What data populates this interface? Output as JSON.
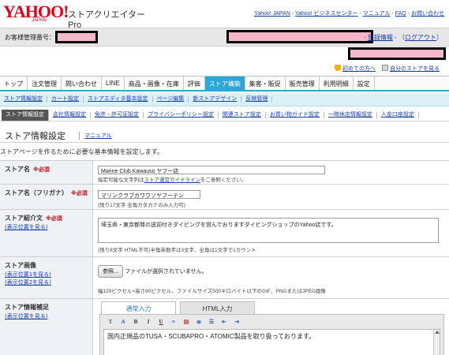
{
  "header": {
    "logo_text": "YAHOO!",
    "logo_sub": "JAPAN",
    "product_name": "ストアクリエイターPro",
    "top_links": [
      "Yahoo! JAPAN",
      "Yahoo! ビジネスセンター",
      "マニュアル",
      "FAQ",
      "お問い合わせ"
    ],
    "separator": " - "
  },
  "account": {
    "label": "お客様管理番号：",
    "links": [
      "登録情報",
      "ログアウト"
    ],
    "sep_open": " - ",
    "paren_open": "（",
    "paren_close": "）"
  },
  "help": {
    "beginner": "初めての方へ",
    "my_store": "自分のストアを見る"
  },
  "main_nav": {
    "tabs": [
      "トップ",
      "注文管理",
      "問い合わせ",
      "LINE",
      "商品・画像・在庫",
      "評価",
      "ストア構築",
      "集客・販促",
      "販売管理",
      "利用明細",
      "設定"
    ],
    "active": "ストア構築"
  },
  "sub_nav_1": [
    "ストア情報設定",
    "カート設定",
    "ストアエディタ基本設定",
    "ページ編集",
    "新ストアデザイン",
    "反映管理"
  ],
  "sub_nav_2": {
    "items": [
      "ストア情報設定",
      "会社情報設定",
      "免許・許可証設定",
      "プライバシーポリシー設定",
      "関連ストア設定",
      "お買い物ガイド設定",
      "一時休店情報設定",
      "入金口座設定"
    ],
    "active": "ストア情報設定"
  },
  "page": {
    "title": "ストア情報設定",
    "manual_link": "マニュアル",
    "description": "ストアページを作るために必要な基本情報を設定します。"
  },
  "form": {
    "required_label": "※必須",
    "store_name": {
      "label": "ストア名",
      "value": "Marine Club Kawauso ヤフー店",
      "note_prefix": "指定可能な文字列は",
      "note_link": "ストア運営ガイドライン",
      "note_suffix": "をご参照ください。"
    },
    "store_name_kana": {
      "label": "ストア名（フリガナ）",
      "value": "マリンクラブカワウソヤフーテン",
      "note": "(残り17文字 全角カタカナのみ入力可)"
    },
    "store_intro": {
      "label": "ストア紹介文",
      "link": "(表示位置を見る)",
      "value": "埼玉県・東京都発の送迎付きダイビングを営んでおりますダイビングショップのYahoo店です。",
      "note": "(残り8文字 HTML不可)半角英数字は3文字、全角は1文字で1カウント"
    },
    "store_image": {
      "label": "ストア画像",
      "links": [
        "(表示位置1を見る)",
        "(表示位置2を見る)"
      ],
      "button": "参照...",
      "status": "ファイルが選択されていません。",
      "note": "幅120ピクセル×高さ80ピクセル、ファイルサイズ500キロバイト以下のGIF、PNGまたはJPEG画像"
    },
    "store_info_extra": {
      "label": "ストア情報補足",
      "link": "(表示位置を見る)",
      "tabs": [
        "通常入力",
        "HTML入力"
      ],
      "active_tab": "通常入力",
      "toolbar": [
        "T",
        "A",
        "B",
        "I",
        "U",
        "≡",
        "▤",
        "≣",
        "☰",
        "⇤",
        "⇥"
      ],
      "content": "国内正規品のTUSA・SCUBAPRO・ATOMIC製品を取り扱っております。"
    }
  },
  "colors": {
    "brand_red": "#e2001a",
    "link_blue": "#1a3fa8",
    "active_tab": "#2aa8d9",
    "subnav_bg": "#dcf0f8",
    "required_red": "#d10000",
    "redaction": "#f5b8cb"
  }
}
